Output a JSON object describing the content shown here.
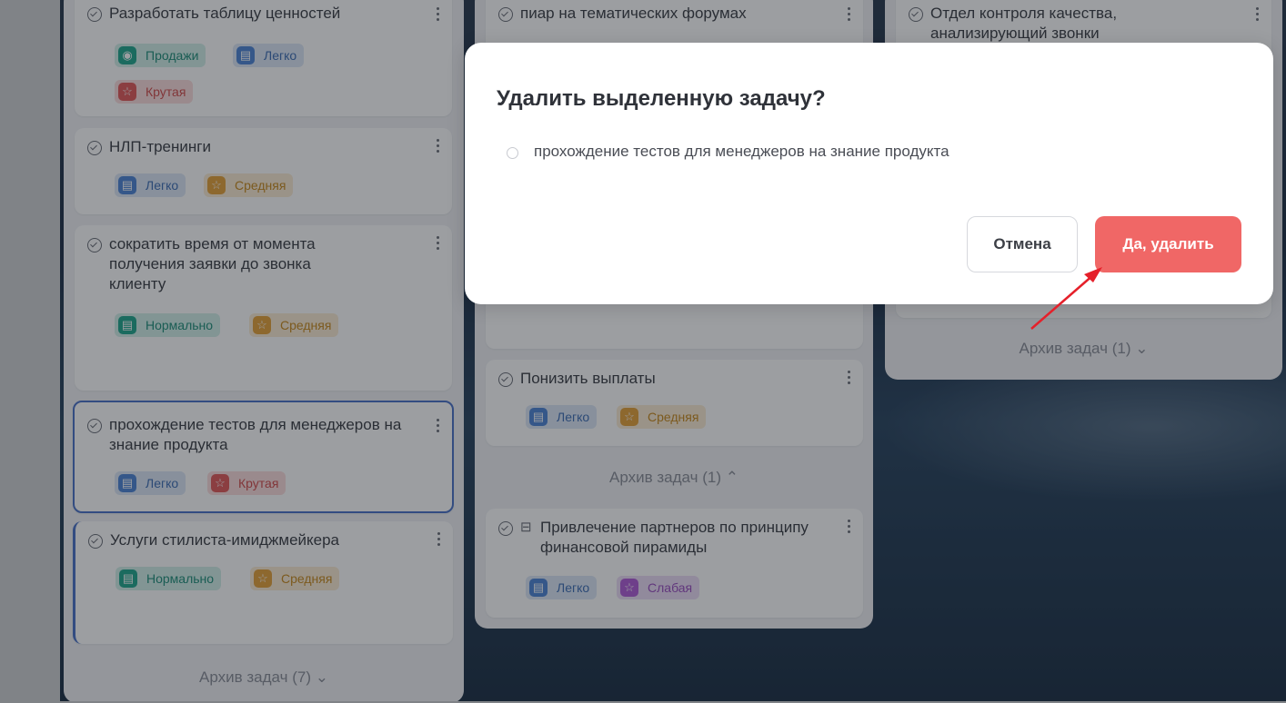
{
  "modal": {
    "title": "Удалить выделенную задачу?",
    "task": "прохождение тестов для менеджеров на знание продукта",
    "cancel_label": "Отмена",
    "confirm_label": "Да, удалить"
  },
  "columns": [
    {
      "cards": [
        {
          "title": "Разработать таблицу ценностей",
          "tags": [
            {
              "label": "Продажи",
              "icon": "eye-icon",
              "color": "#22a88e"
            },
            {
              "label": "Легко",
              "icon": "film-icon",
              "color": "#4f86d6"
            },
            {
              "label": "Крутая",
              "icon": "star-icon",
              "color": "#e25b5b"
            }
          ]
        },
        {
          "title": "НЛП-тренинги",
          "tags": [
            {
              "label": "Легко",
              "icon": "film-icon",
              "color": "#4f86d6"
            },
            {
              "label": "Средняя",
              "icon": "star-icon",
              "color": "#e6a23a"
            }
          ]
        },
        {
          "title": "сократить время от момента получения заявки до звонка клиенту",
          "tags": [
            {
              "label": "Нормально",
              "icon": "film-icon",
              "color": "#22a88e"
            },
            {
              "label": "Средняя",
              "icon": "star-icon",
              "color": "#e6a23a"
            }
          ]
        },
        {
          "title": "прохождение тестов для менеджеров на знание продукта",
          "tags": [
            {
              "label": "Легко",
              "icon": "film-icon",
              "color": "#4f86d6"
            },
            {
              "label": "Крутая",
              "icon": "star-icon",
              "color": "#e25b5b"
            }
          ]
        },
        {
          "title": "Услуги стилиста-имиджмейкера",
          "tags": [
            {
              "label": "Нормально",
              "icon": "film-icon",
              "color": "#22a88e"
            },
            {
              "label": "Средняя",
              "icon": "star-icon",
              "color": "#e6a23a"
            }
          ]
        }
      ],
      "archive": "Архив задач (7)"
    },
    {
      "cards": [
        {
          "title": "пиар на тематических форумах",
          "tags": []
        },
        {
          "title": "Понизить выплаты",
          "tags": [
            {
              "label": "Легко",
              "icon": "film-icon",
              "color": "#4f86d6"
            },
            {
              "label": "Средняя",
              "icon": "star-icon",
              "color": "#e6a23a"
            }
          ]
        },
        {
          "title": "Привлечение партнеров по принципу финансовой пирамиды",
          "tags": [
            {
              "label": "Легко",
              "icon": "film-icon",
              "color": "#4f86d6"
            },
            {
              "label": "Слабая",
              "icon": "star-icon",
              "color": "#b05cd8"
            }
          ]
        }
      ],
      "archive": "Архив задач (1)"
    },
    {
      "cards": [
        {
          "title": "Отдел контроля качества, анализирующий звонки",
          "tags": []
        }
      ],
      "archive": "Архив задач (1)"
    }
  ]
}
